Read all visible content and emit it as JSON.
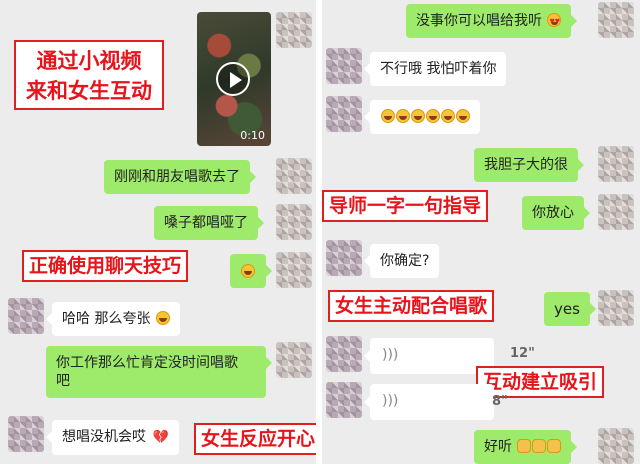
{
  "left_chat": {
    "video": {
      "duration": "0:10"
    },
    "messages": [
      {
        "text": "刚刚和朋友唱歌去了"
      },
      {
        "text": "嗓子都唱哑了"
      },
      {
        "text": "哈哈 那么夸张"
      },
      {
        "line1": "你工作那么忙肯定没时间唱歌",
        "line2": "吧"
      },
      {
        "text": "想唱没机会哎"
      }
    ],
    "annotations": {
      "video_interaction_line1": "通过小视频",
      "video_interaction_line2": "来和女生互动",
      "chat_skills": "正确使用聊天技巧",
      "girl_happy": "女生反应开心"
    }
  },
  "right_chat": {
    "messages": [
      {
        "text": "没事你可以唱给我听"
      },
      {
        "text": "不行哦 我怕吓着你"
      },
      {
        "text": "我胆子大的很"
      },
      {
        "text": "你放心"
      },
      {
        "text": "你确定?"
      },
      {
        "text": "yes"
      },
      {
        "text": "好听"
      }
    ],
    "voice_messages": [
      {
        "duration": "12\""
      },
      {
        "duration": "8\""
      }
    ],
    "annotations": {
      "mentor_guidance": "导师一字一句指导",
      "girl_sings": "女生主动配合唱歌",
      "build_attraction": "互动建立吸引"
    }
  },
  "emoji_icons": [
    "laugh-emoji-icon",
    "heart-eyes-emoji-icon",
    "broken-heart-icon",
    "clap-emoji-icon"
  ]
}
